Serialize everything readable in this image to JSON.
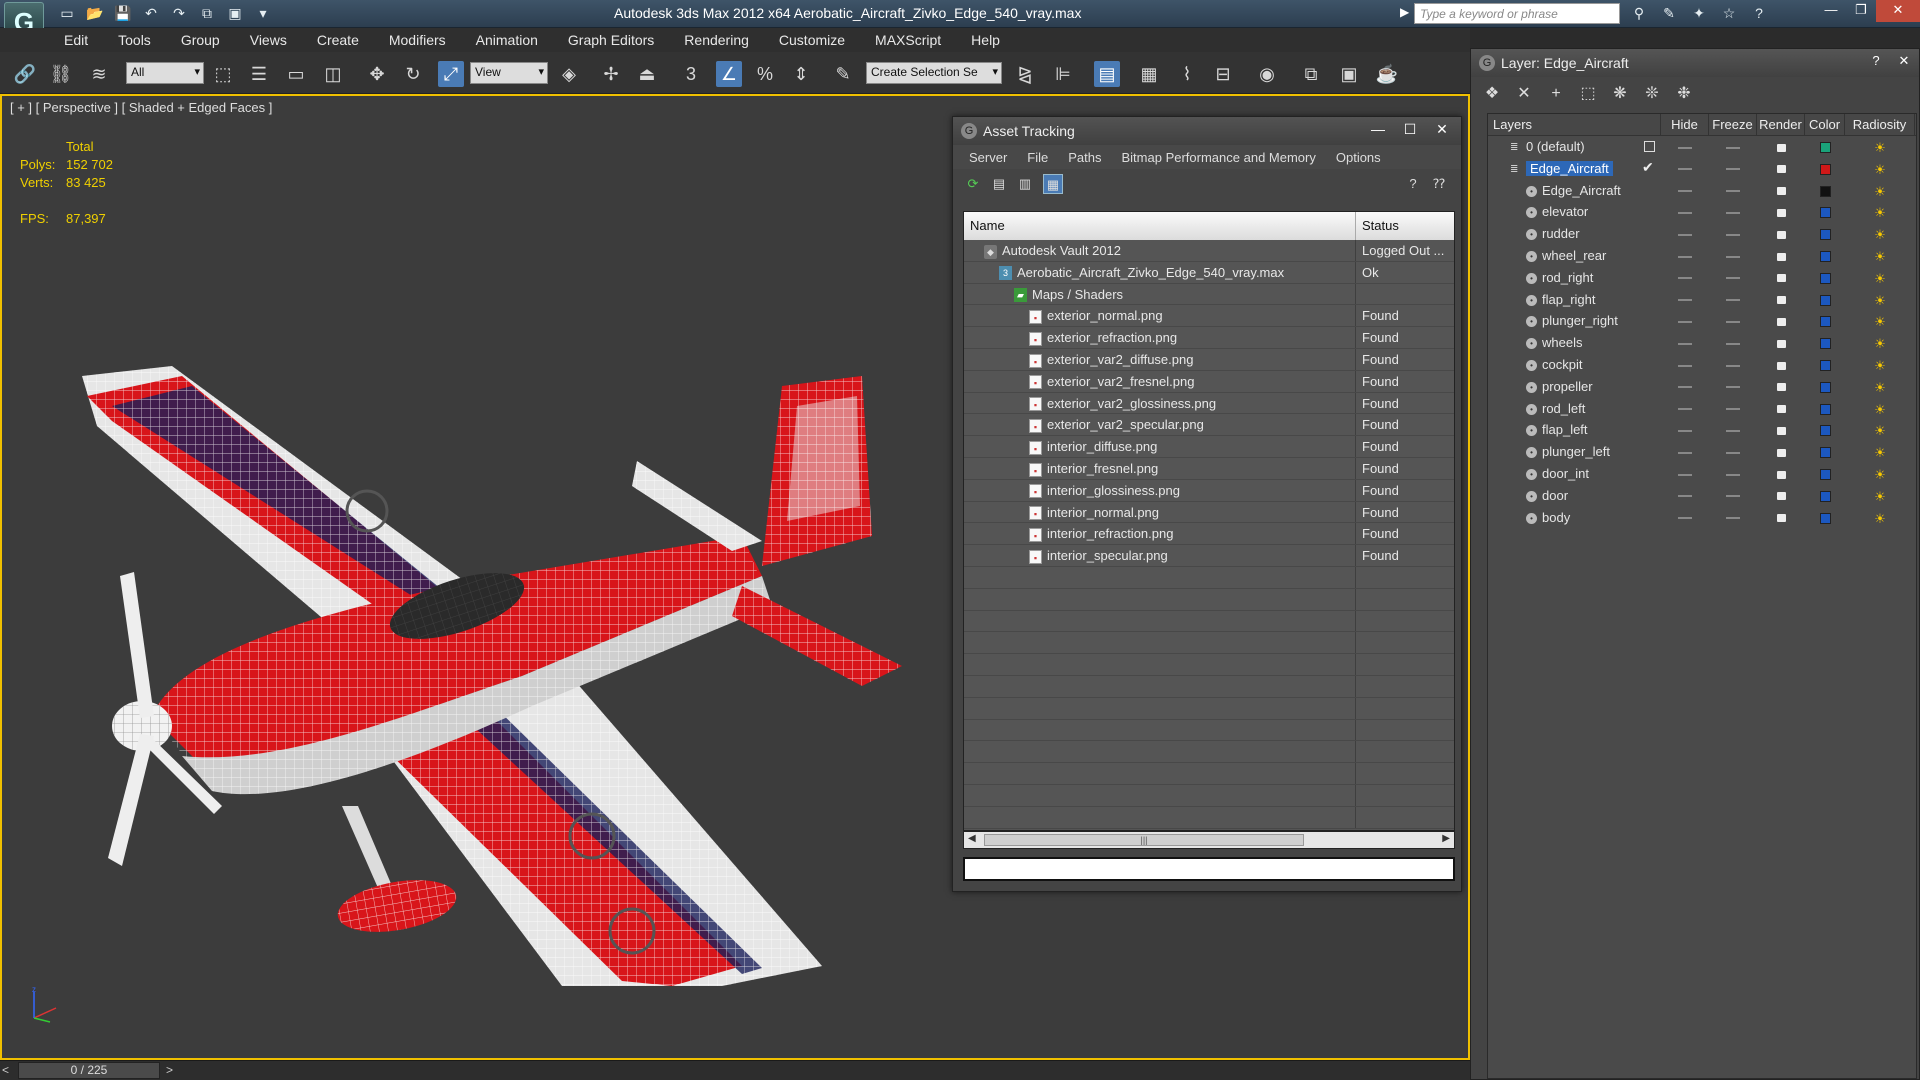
{
  "window": {
    "title": "Autodesk 3ds Max  2012 x64      Aerobatic_Aircraft_Zivko_Edge_540_vray.max",
    "search_placeholder": "Type a keyword or phrase"
  },
  "menubar": [
    "Edit",
    "Tools",
    "Group",
    "Views",
    "Create",
    "Modifiers",
    "Animation",
    "Graph Editors",
    "Rendering",
    "Customize",
    "MAXScript",
    "Help"
  ],
  "toolbar": {
    "selection_filter": "All",
    "reference_coord": "View",
    "named_selection": "Create Selection Se"
  },
  "viewport": {
    "label": "[ + ] [ Perspective ] [ Shaded + Edged Faces ]",
    "stats": {
      "total_label": "Total",
      "polys_label": "Polys:",
      "polys_value": "152 702",
      "verts_label": "Verts:",
      "verts_value": "83 425",
      "fps_label": "FPS:",
      "fps_value": "87,397"
    }
  },
  "timeline": {
    "prev": "<",
    "position": "0 / 225",
    "next": ">"
  },
  "asset_tracking": {
    "title": "Asset Tracking",
    "menu": [
      "Server",
      "File",
      "Paths",
      "Bitmap Performance and Memory",
      "Options"
    ],
    "columns": {
      "name": "Name",
      "status": "Status"
    },
    "rows": [
      {
        "name": "Autodesk Vault 2012",
        "status": "Logged Out ...",
        "type": "vault",
        "indent": 0
      },
      {
        "name": "Aerobatic_Aircraft_Zivko_Edge_540_vray.max",
        "status": "Ok",
        "type": "max",
        "indent": 1
      },
      {
        "name": "Maps / Shaders",
        "status": "",
        "type": "folder",
        "indent": 2
      },
      {
        "name": "exterior_normal.png",
        "status": "Found",
        "type": "png",
        "indent": 3
      },
      {
        "name": "exterior_refraction.png",
        "status": "Found",
        "type": "png",
        "indent": 3
      },
      {
        "name": "exterior_var2_diffuse.png",
        "status": "Found",
        "type": "png",
        "indent": 3
      },
      {
        "name": "exterior_var2_fresnel.png",
        "status": "Found",
        "type": "png",
        "indent": 3
      },
      {
        "name": "exterior_var2_glossiness.png",
        "status": "Found",
        "type": "png",
        "indent": 3
      },
      {
        "name": "exterior_var2_specular.png",
        "status": "Found",
        "type": "png",
        "indent": 3
      },
      {
        "name": "interior_diffuse.png",
        "status": "Found",
        "type": "png",
        "indent": 3
      },
      {
        "name": "interior_fresnel.png",
        "status": "Found",
        "type": "png",
        "indent": 3
      },
      {
        "name": "interior_glossiness.png",
        "status": "Found",
        "type": "png",
        "indent": 3
      },
      {
        "name": "interior_normal.png",
        "status": "Found",
        "type": "png",
        "indent": 3
      },
      {
        "name": "interior_refraction.png",
        "status": "Found",
        "type": "png",
        "indent": 3
      },
      {
        "name": "interior_specular.png",
        "status": "Found",
        "type": "png",
        "indent": 3
      }
    ],
    "empty_rows": 12
  },
  "layer_window": {
    "title": "Layer: Edge_Aircraft",
    "columns": [
      "Layers",
      "Hide",
      "Freeze",
      "Render",
      "Color",
      "Radiosity"
    ],
    "rows": [
      {
        "name": "0 (default)",
        "kind": "layer",
        "color": "#1aa37a",
        "selected": false,
        "checkbox": true
      },
      {
        "name": "Edge_Aircraft",
        "kind": "layer",
        "color": "#d01818",
        "selected": true,
        "current": true
      },
      {
        "name": "Edge_Aircraft",
        "kind": "object",
        "color": "#111111"
      },
      {
        "name": "elevator",
        "kind": "object",
        "color": "#1c58c0"
      },
      {
        "name": "rudder",
        "kind": "object",
        "color": "#1c58c0"
      },
      {
        "name": "wheel_rear",
        "kind": "object",
        "color": "#1c58c0"
      },
      {
        "name": "rod_right",
        "kind": "object",
        "color": "#1c58c0"
      },
      {
        "name": "flap_right",
        "kind": "object",
        "color": "#1c58c0"
      },
      {
        "name": "plunger_right",
        "kind": "object",
        "color": "#1c58c0"
      },
      {
        "name": "wheels",
        "kind": "object",
        "color": "#1c58c0"
      },
      {
        "name": "cockpit",
        "kind": "object",
        "color": "#1c58c0"
      },
      {
        "name": "propeller",
        "kind": "object",
        "color": "#1c58c0"
      },
      {
        "name": "rod_left",
        "kind": "object",
        "color": "#1c58c0"
      },
      {
        "name": "flap_left",
        "kind": "object",
        "color": "#1c58c0"
      },
      {
        "name": "plunger_left",
        "kind": "object",
        "color": "#1c58c0"
      },
      {
        "name": "door_int",
        "kind": "object",
        "color": "#1c58c0"
      },
      {
        "name": "door",
        "kind": "object",
        "color": "#1c58c0"
      },
      {
        "name": "body",
        "kind": "object",
        "color": "#1c58c0"
      }
    ]
  },
  "colors": {
    "viewport_border": "#f0c000",
    "aircraft_red": "#d8151a",
    "aircraft_white": "#f4f4f4",
    "selection_blue": "#2d68b8"
  }
}
